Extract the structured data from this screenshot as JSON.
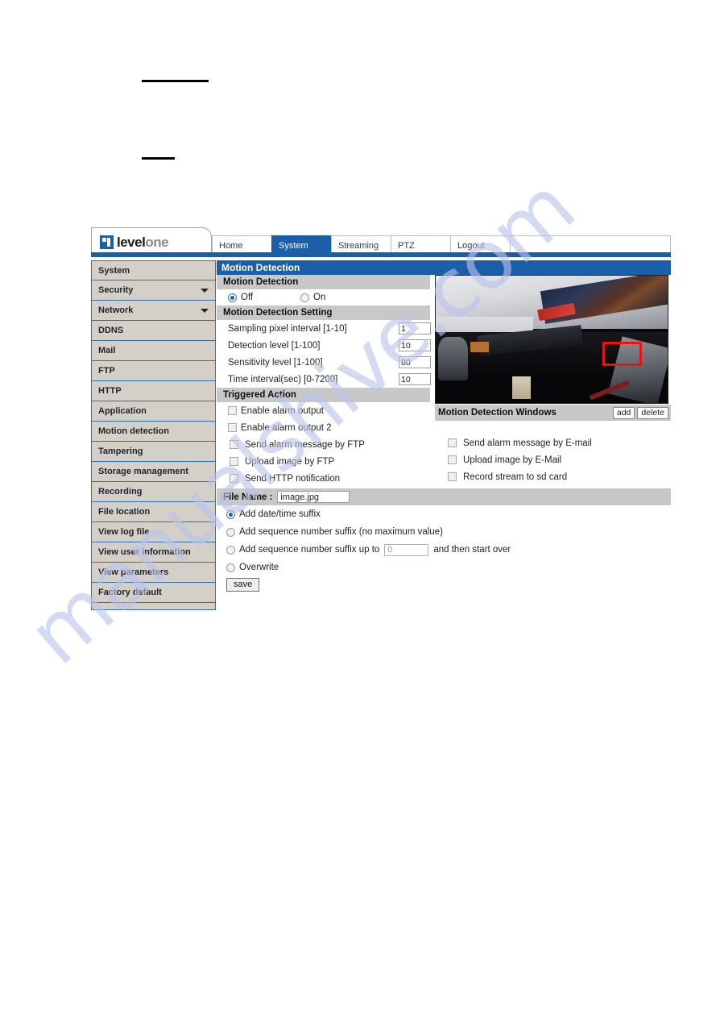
{
  "document": {
    "watermark": "manualshive.com"
  },
  "header": {
    "logo": {
      "part1": "level",
      "part2": "one"
    },
    "tabs": [
      {
        "label": "Home",
        "active": false
      },
      {
        "label": "System",
        "active": true
      },
      {
        "label": "Streaming",
        "active": false
      },
      {
        "label": "PTZ",
        "active": false
      },
      {
        "label": "Logout",
        "active": false
      }
    ]
  },
  "sidebar": {
    "items": [
      {
        "label": "System",
        "caret": false
      },
      {
        "label": "Security",
        "caret": true
      },
      {
        "label": "Network",
        "caret": true
      },
      {
        "label": "DDNS",
        "caret": false
      },
      {
        "label": "Mail",
        "caret": false
      },
      {
        "label": "FTP",
        "caret": false
      },
      {
        "label": "HTTP",
        "caret": false
      },
      {
        "label": "Application",
        "caret": false
      },
      {
        "label": "Motion detection",
        "caret": false
      },
      {
        "label": "Tampering",
        "caret": false
      },
      {
        "label": "Storage management",
        "caret": false
      },
      {
        "label": "Recording",
        "caret": false
      },
      {
        "label": "File location",
        "caret": false
      },
      {
        "label": "View log file",
        "caret": false
      },
      {
        "label": "View user information",
        "caret": false
      },
      {
        "label": "View parameters",
        "caret": false
      },
      {
        "label": "Factory default",
        "caret": false
      }
    ]
  },
  "page": {
    "title": "Motion Detection"
  },
  "motion_detection": {
    "section_label": "Motion Detection",
    "off_label": "Off",
    "on_label": "On",
    "selected": "Off"
  },
  "motion_detection_setting": {
    "section_label": "Motion Detection Setting",
    "fields": [
      {
        "label": "Sampling pixel interval [1-10]",
        "value": "1"
      },
      {
        "label": "Detection level [1-100]",
        "value": "10"
      },
      {
        "label": "Sensitivity level [1-100]",
        "value": "80"
      },
      {
        "label": "Time interval(sec) [0-7200]",
        "value": "10"
      }
    ]
  },
  "triggered_action": {
    "section_label": "Triggered Action",
    "left_items": [
      {
        "label": "Enable alarm output",
        "checked": false
      },
      {
        "label": "Enable alarm output 2",
        "checked": false
      },
      {
        "label": "Send alarm message by FTP",
        "checked": false
      },
      {
        "label": "Upload image by FTP",
        "checked": false
      },
      {
        "label": "Send HTTP notification",
        "checked": false
      }
    ],
    "right_items": [
      {
        "label": "Send alarm message by E-mail",
        "checked": false
      },
      {
        "label": "Upload image by E-Mail",
        "checked": false
      },
      {
        "label": "Record stream to sd card",
        "checked": false
      }
    ]
  },
  "video": {
    "md_windows_label": "Motion Detection Windows",
    "add_label": "add",
    "delete_label": "delete"
  },
  "file_name": {
    "label": "File Name :",
    "value": "image.jpg",
    "options": [
      {
        "label": "Add date/time suffix",
        "selected": true
      },
      {
        "label": "Add sequence number suffix (no maximum value)",
        "selected": false
      },
      {
        "label": "Add sequence number suffix up to",
        "selected": false
      },
      {
        "label": "Overwrite",
        "selected": false
      }
    ],
    "seq_value": "0",
    "seq_suffix_text": "and then start over",
    "save_label": "save"
  }
}
